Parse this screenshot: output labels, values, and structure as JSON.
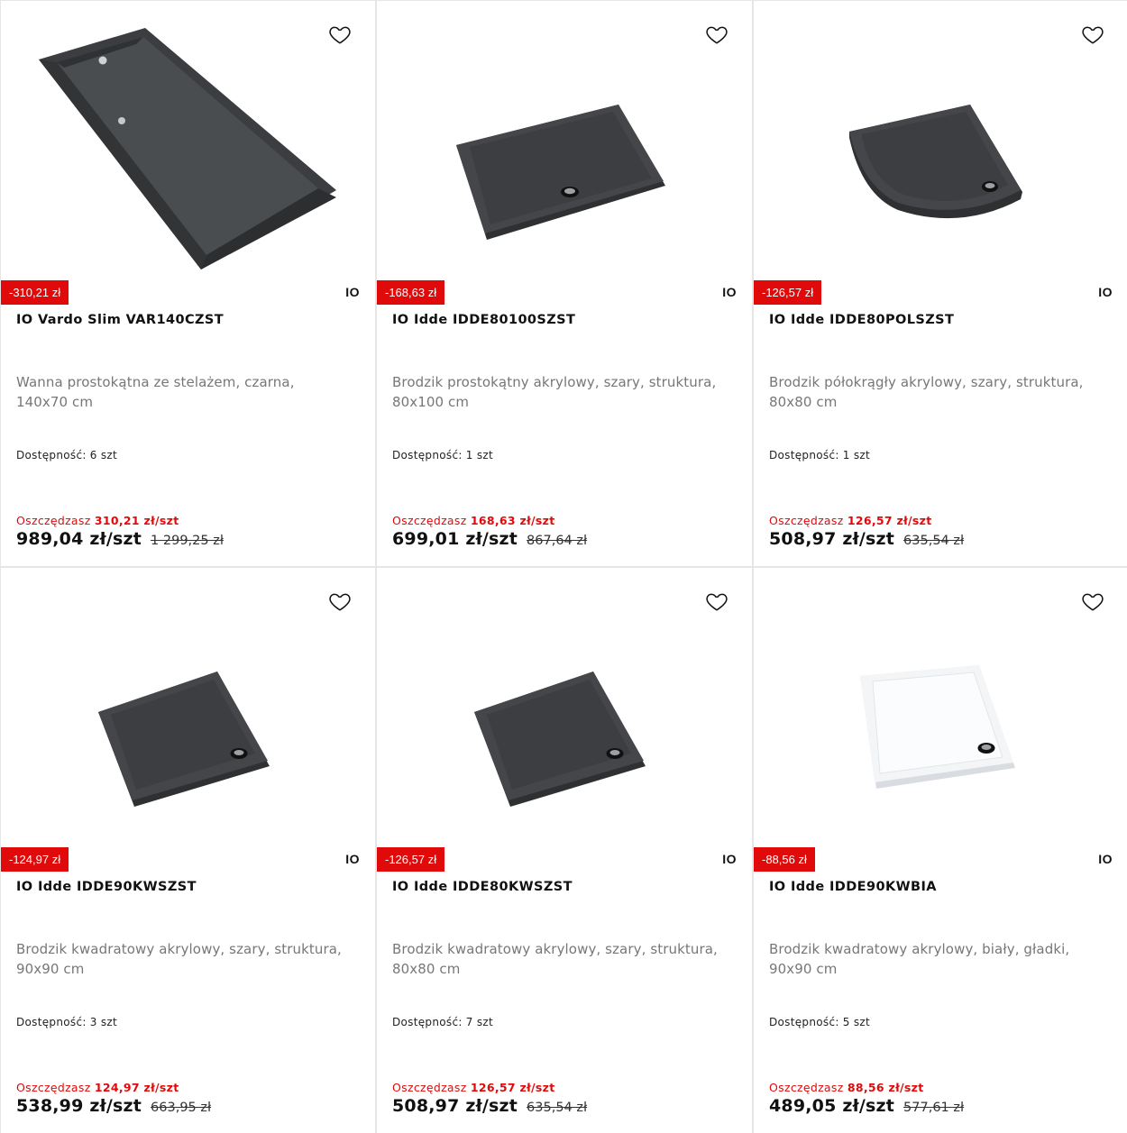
{
  "colors": {
    "accent": "#e10a0a",
    "dark_product": "#3a3a3a",
    "white_product": "#f4f6f8"
  },
  "icons": {
    "favorite": "heart-outline-icon"
  },
  "products": [
    {
      "discount": "-310,21 zł",
      "brand": "IO",
      "title": "IO Vardo Slim VAR140CZST",
      "description": "Wanna prostokątna ze stelażem, czarna, 140x70 cm",
      "availability": "Dostępność: 6 szt",
      "save_label": "Oszczędzasz ",
      "save_amount": "310,21 zł/szt",
      "price": "989,04 zł/szt",
      "old_price": "1 299,25 zł",
      "image": "black-bathtub"
    },
    {
      "discount": "-168,63 zł",
      "brand": "IO",
      "title": "IO Idde IDDE80100SZST",
      "description": "Brodzik prostokątny akrylowy, szary, struktura, 80x100 cm",
      "availability": "Dostępność: 1 szt",
      "save_label": "Oszczędzasz ",
      "save_amount": "168,63 zł/szt",
      "price": "699,01 zł/szt",
      "old_price": "867,64 zł",
      "image": "grey-rectangular-tray"
    },
    {
      "discount": "-126,57 zł",
      "brand": "IO",
      "title": "IO Idde IDDE80POLSZST",
      "description": "Brodzik półokrągły akrylowy, szary, struktura, 80x80 cm",
      "availability": "Dostępność: 1 szt",
      "save_label": "Oszczędzasz ",
      "save_amount": "126,57 zł/szt",
      "price": "508,97 zł/szt",
      "old_price": "635,54 zł",
      "image": "grey-quarter-round-tray"
    },
    {
      "discount": "-124,97 zł",
      "brand": "IO",
      "title": "IO Idde IDDE90KWSZST",
      "description": "Brodzik kwadratowy akrylowy, szary, struktura, 90x90 cm",
      "availability": "Dostępność: 3 szt",
      "save_label": "Oszczędzasz ",
      "save_amount": "124,97 zł/szt",
      "price": "538,99 zł/szt",
      "old_price": "663,95 zł",
      "image": "grey-square-tray"
    },
    {
      "discount": "-126,57 zł",
      "brand": "IO",
      "title": "IO Idde IDDE80KWSZST",
      "description": "Brodzik kwadratowy akrylowy, szary, struktura, 80x80 cm",
      "availability": "Dostępność: 7 szt",
      "save_label": "Oszczędzasz ",
      "save_amount": "126,57 zł/szt",
      "price": "508,97 zł/szt",
      "old_price": "635,54 zł",
      "image": "grey-square-tray"
    },
    {
      "discount": "-88,56 zł",
      "brand": "IO",
      "title": "IO Idde IDDE90KWBIA",
      "description": "Brodzik kwadratowy akrylowy, biały, gładki, 90x90 cm",
      "availability": "Dostępność: 5 szt",
      "save_label": "Oszczędzasz ",
      "save_amount": "88,56 zł/szt",
      "price": "489,05 zł/szt",
      "old_price": "577,61 zł",
      "image": "white-square-tray"
    }
  ]
}
